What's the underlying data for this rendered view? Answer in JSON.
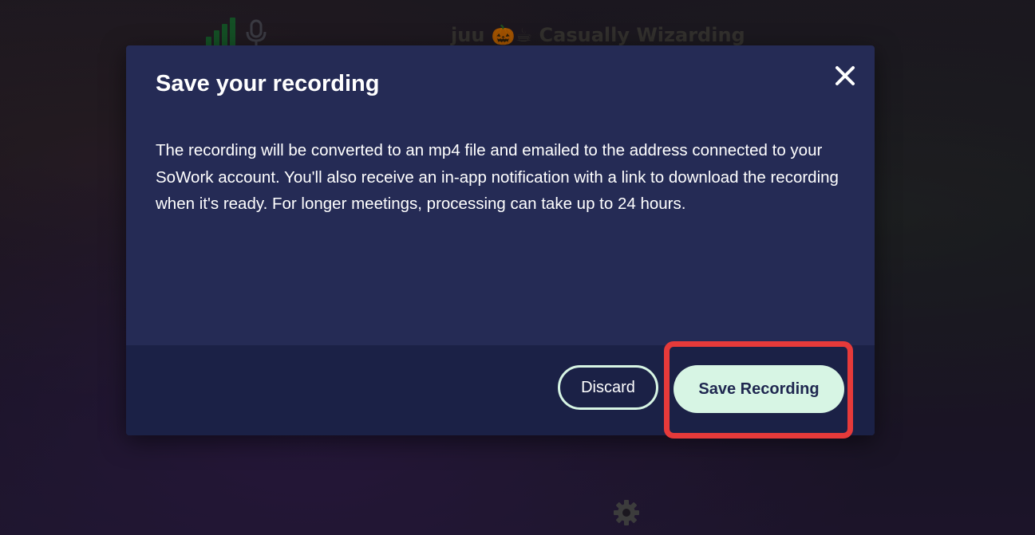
{
  "scene": {
    "player_label": "juu 🎃☕ Casually Wizarding"
  },
  "modal": {
    "title": "Save your recording",
    "body": "The recording will be converted to an mp4 file and emailed to the address connected to your SoWork account. You'll also receive an in-app notification with a link to download the recording when it's ready. For longer meetings, processing can take up to 24 hours.",
    "close_icon": "close-icon",
    "discard_label": "Discard",
    "save_label": "Save Recording"
  },
  "colors": {
    "modal_bg": "#252b55",
    "footer_bg": "#1b2146",
    "button_mint": "#d7f5e4",
    "highlight": "#e63a3a"
  }
}
